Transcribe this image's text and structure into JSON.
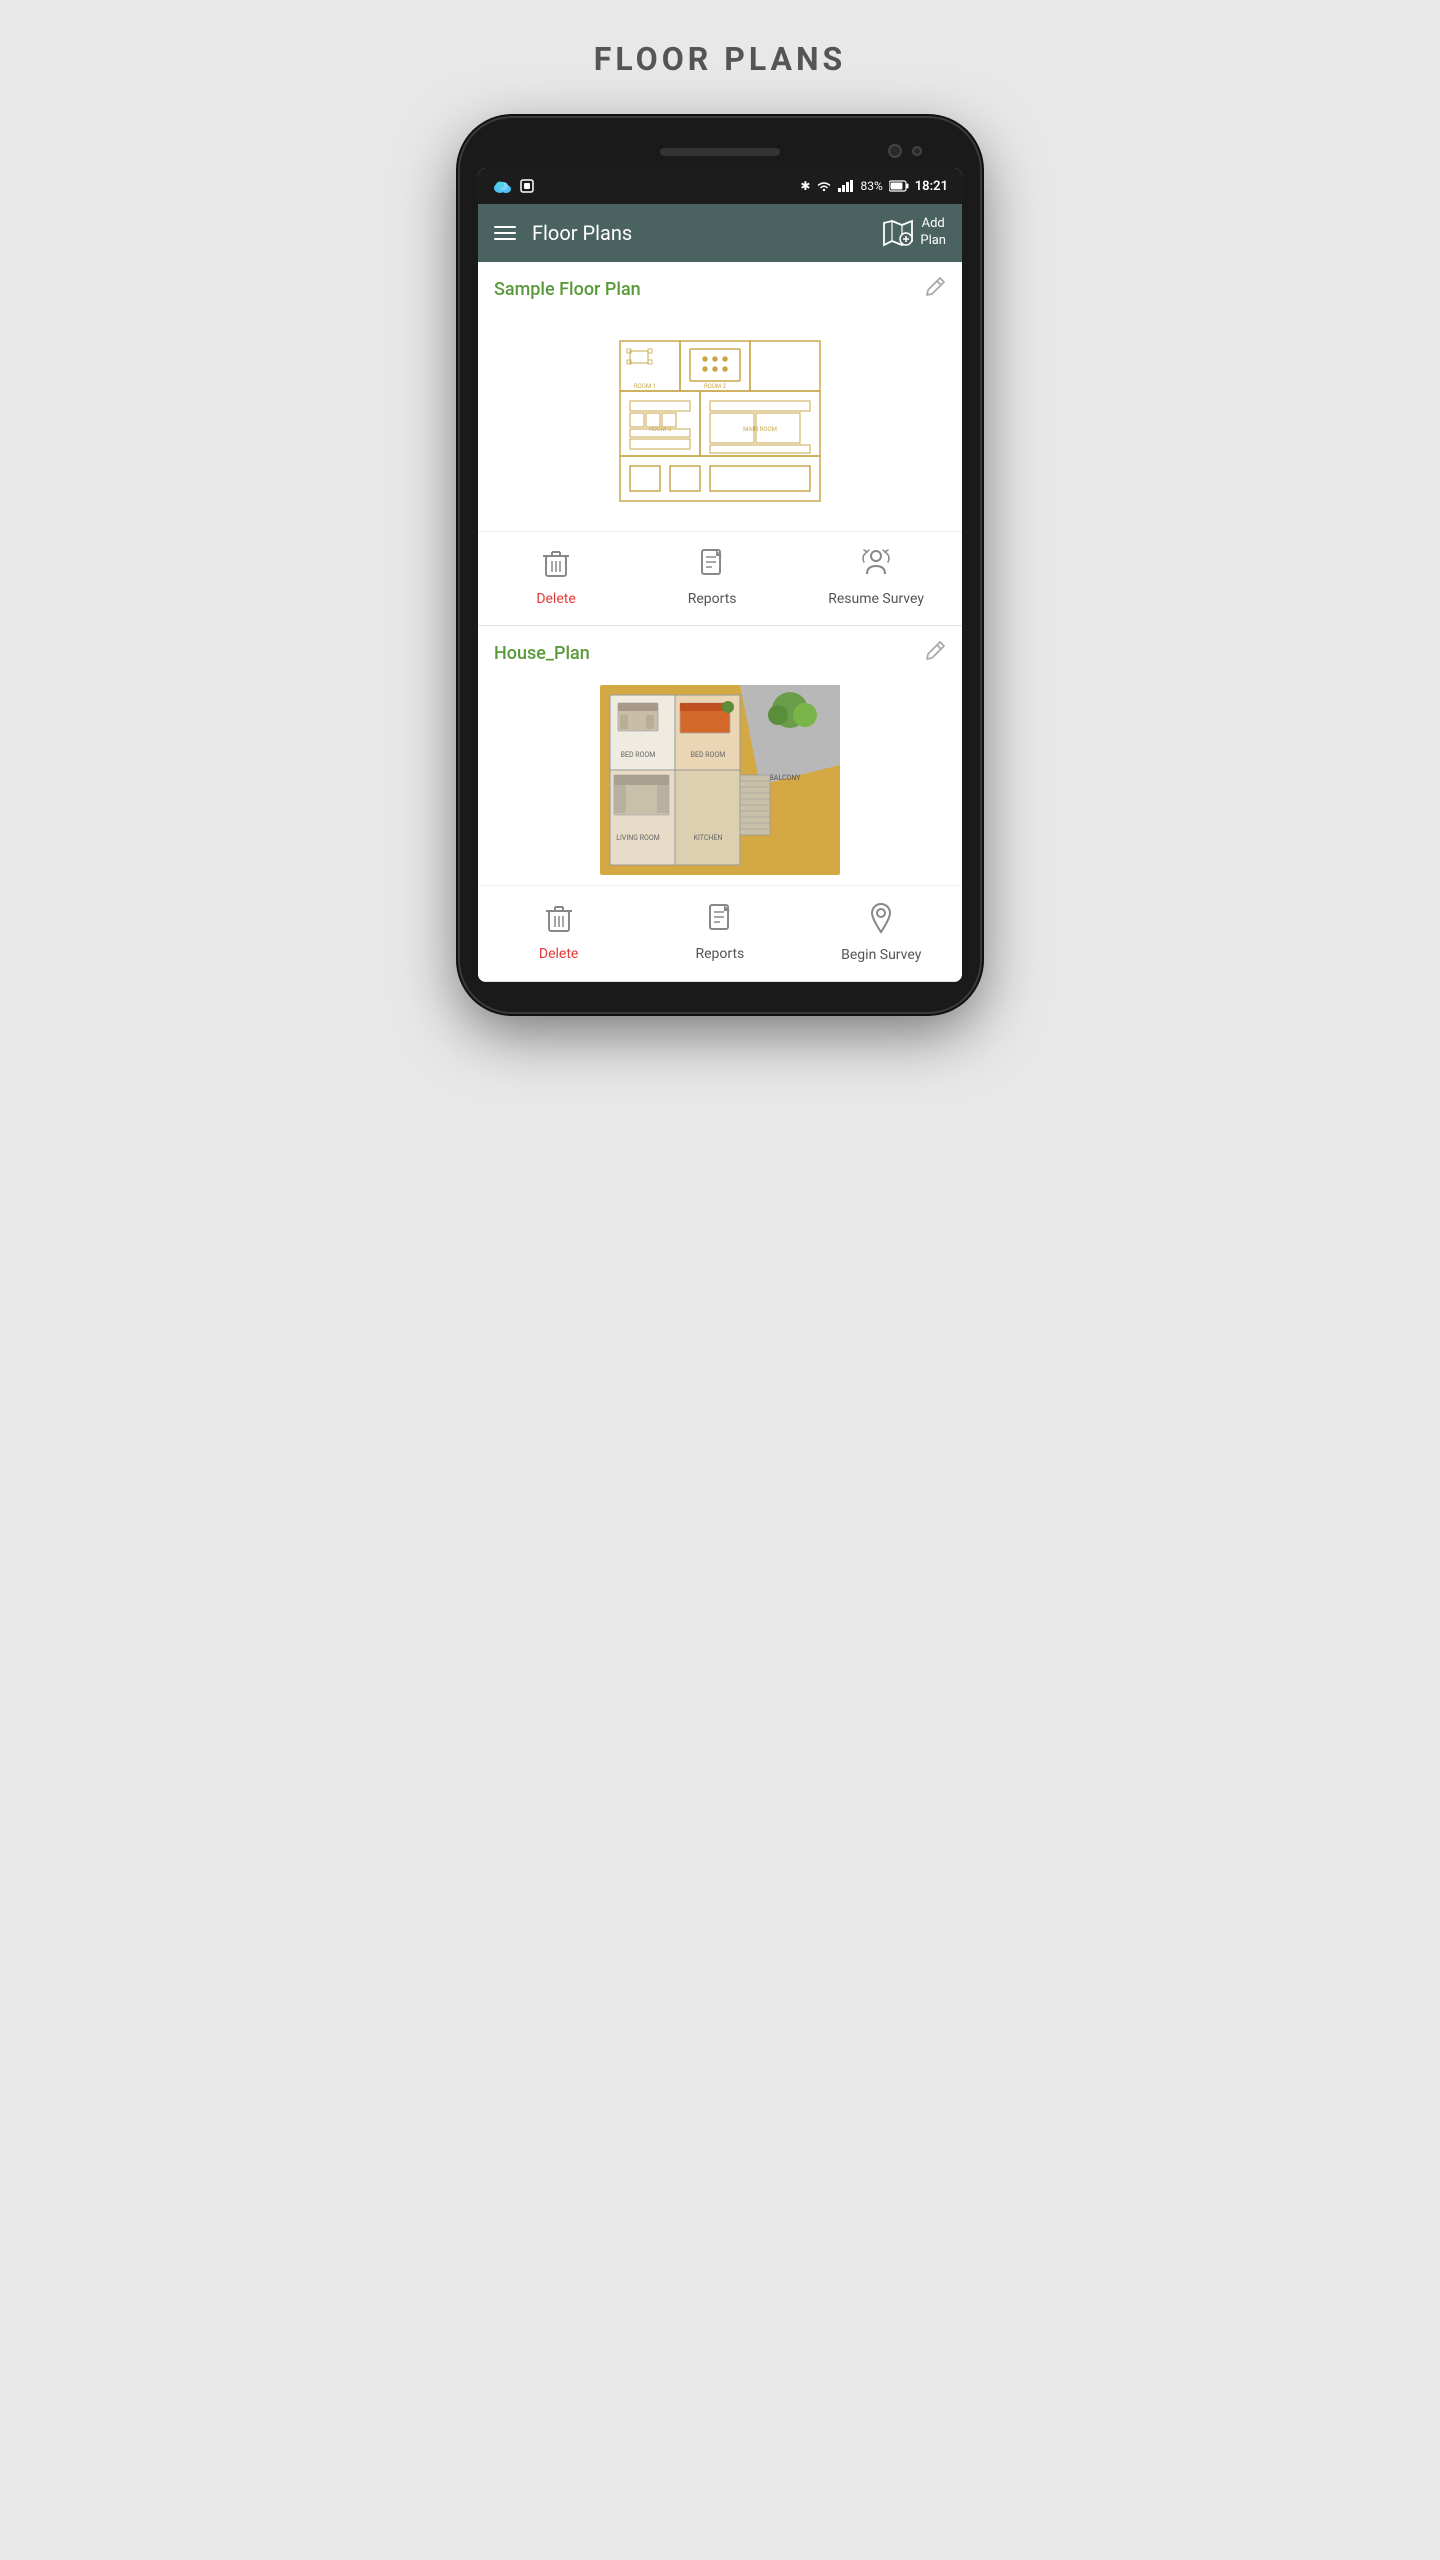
{
  "page": {
    "title": "FLOOR PLANS"
  },
  "status_bar": {
    "battery": "83%",
    "time": "18:21",
    "signal_icon": "📶",
    "wifi_icon": "WiFi",
    "bluetooth_icon": "BT"
  },
  "app_header": {
    "title": "Floor Plans",
    "add_button_line1": "Add",
    "add_button_line2": "Plan"
  },
  "floor_plans": [
    {
      "id": "plan-1",
      "title": "Sample Floor Plan",
      "type": "schematic",
      "actions": {
        "delete": "Delete",
        "reports": "Reports",
        "survey": "Resume Survey"
      }
    },
    {
      "id": "plan-2",
      "title": "House_Plan",
      "type": "image",
      "actions": {
        "delete": "Delete",
        "reports": "Reports",
        "survey": "Begin Survey"
      }
    }
  ],
  "icons": {
    "menu": "☰",
    "edit": "✏",
    "delete": "🗑",
    "reports": "📄",
    "resume_survey": "📍",
    "begin_survey": "📍",
    "add_plan": "🗺",
    "bluetooth": "⚡",
    "battery": "🔋"
  }
}
